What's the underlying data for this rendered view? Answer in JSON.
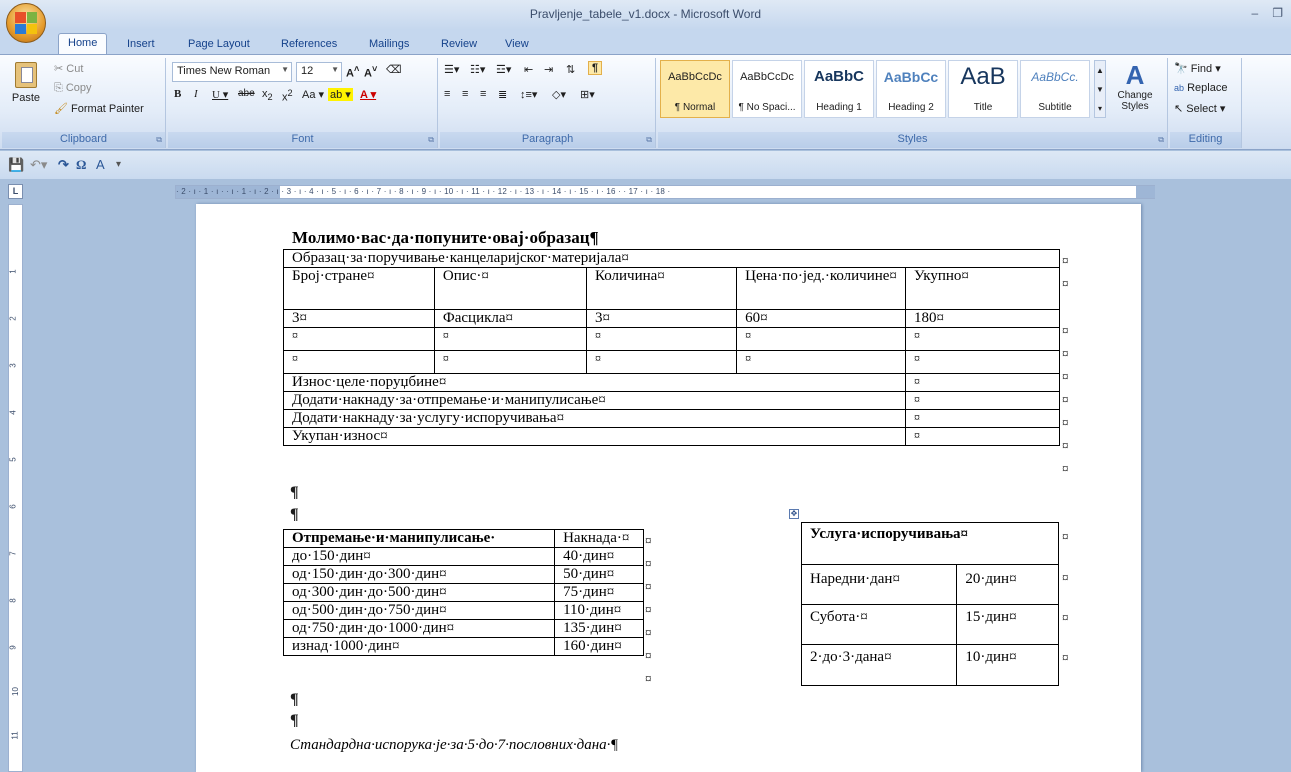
{
  "window": {
    "title": "Pravljenje_tabele_v1.docx - Microsoft Word"
  },
  "tabs": [
    "Home",
    "Insert",
    "Page Layout",
    "References",
    "Mailings",
    "Review",
    "View"
  ],
  "ribbon": {
    "clipboard": {
      "label": "Clipboard",
      "paste": "Paste",
      "cut": "Cut",
      "copy": "Copy",
      "format_painter": "Format Painter"
    },
    "font": {
      "label": "Font",
      "family": "Times New Roman",
      "size": "12"
    },
    "paragraph": {
      "label": "Paragraph"
    },
    "styles": {
      "label": "Styles",
      "items": [
        {
          "sample": "AaBbCcDc",
          "name": "¶ Normal"
        },
        {
          "sample": "AaBbCcDc",
          "name": "¶ No Spaci..."
        },
        {
          "sample": "AaBbC",
          "name": "Heading 1"
        },
        {
          "sample": "AaBbCc",
          "name": "Heading 2"
        },
        {
          "sample": "AaB",
          "name": "Title"
        },
        {
          "sample": "AaBbCc.",
          "name": "Subtitle"
        }
      ],
      "change_styles": "Change Styles"
    },
    "editing": {
      "label": "Editing",
      "find": "Find",
      "replace": "Replace",
      "select": "Select"
    }
  },
  "ruler": {
    "numbers": "· 2 · ı · 1 · ı ·  · ı · 1 · ı · 2 · ı · 3 · ı · 4 · ı · 5 · ı · 6 · ı · 7 · ı · 8 · ı · 9 · ı · 10 · ı · 11 · ı · 12 · ı · 13 · ı · 14 · ı · 15 · ı · 16 ·  · 17 · ı · 18 ·",
    "vertical": [
      "1",
      "2",
      "3",
      "4",
      "5",
      "6",
      "7",
      "8",
      "9",
      "10",
      "11"
    ]
  },
  "document": {
    "heading": "Молимо·вас·да·попуните·овај·образац¶",
    "order_table": {
      "title": "Образац·за·поручивање·канцеларијског·материјала¤",
      "headers": [
        "Број·стране¤",
        "Опис·¤",
        "Количина¤",
        "Цена·по·јед.·количине¤",
        "Укупно¤"
      ],
      "rows": [
        [
          "3¤",
          "Фасцикла¤",
          "3¤",
          "60¤",
          "180¤"
        ],
        [
          "¤",
          "¤",
          "¤",
          "¤",
          "¤"
        ],
        [
          "¤",
          "¤",
          "¤",
          "¤",
          "¤"
        ]
      ],
      "summary": [
        [
          "Износ·целе·поруџбине¤",
          "¤"
        ],
        [
          "Додати·накнаду·за·отпремање·и·манипулисање¤",
          "¤"
        ],
        [
          "Додати·накнаду·за·услугу·испоручивања¤",
          "¤"
        ],
        [
          "Укупан·износ¤",
          "¤"
        ]
      ]
    },
    "pilcrow": "¶",
    "cell_end": "¤",
    "shipping_table": {
      "headers": [
        "Отпремање·и·манипулисање·",
        "Накнада·¤"
      ],
      "rows": [
        [
          "до·150·дин¤",
          "40·дин¤"
        ],
        [
          "од·150·дин·до·300·дин¤",
          "50·дин¤"
        ],
        [
          "од·300·дин·до·500·дин¤",
          "75·дин¤"
        ],
        [
          "од·500·дин·до·750·дин¤",
          "110·дин¤"
        ],
        [
          "од·750·дин·до·1000·дин¤",
          "135·дин¤"
        ],
        [
          "изнад·1000·дин¤",
          "160·дин¤"
        ]
      ]
    },
    "delivery_table": {
      "title": "Услуга·испоручивања¤",
      "rows": [
        [
          "Наредни·дан¤",
          "20·дин¤"
        ],
        [
          "Субота·¤",
          "15·дин¤"
        ],
        [
          "2·до·3·дана¤",
          "10·дин¤"
        ]
      ]
    },
    "footer_note": "Стандардна·испорука·је·за·5·до·7·пословних·дана·¶"
  }
}
